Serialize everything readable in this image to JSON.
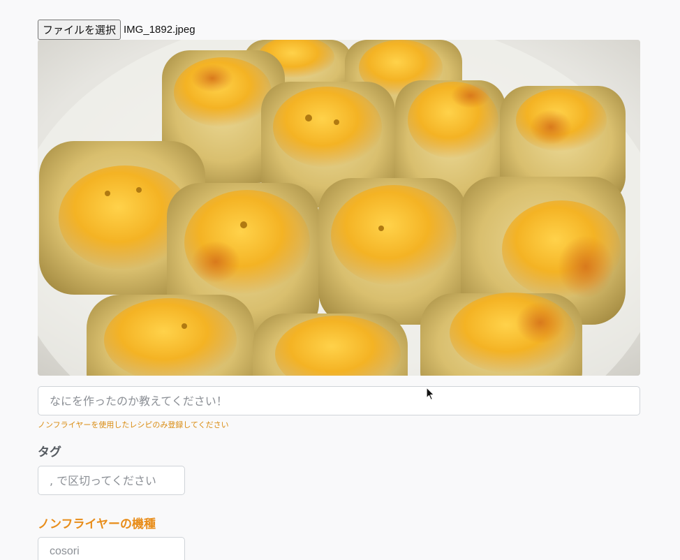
{
  "file_picker": {
    "button_label": "ファイルを選択",
    "file_name": "IMG_1892.jpeg"
  },
  "photo": {
    "subject": "cheese-topped baked bread cubes on a white plate"
  },
  "title_field": {
    "placeholder": "なにを作ったのか教えてください！"
  },
  "hint": {
    "text": "ノンフライヤーを使用したレシピのみ登録してください"
  },
  "tags": {
    "label": "タグ",
    "placeholder": ", で区切ってください"
  },
  "machine": {
    "label": "ノンフライヤーの機種",
    "placeholder": "cosori"
  },
  "colors": {
    "accent_orange": "#e88d1a",
    "hint_orange": "#d98b10",
    "label_gray": "#555a60",
    "input_border": "#cfd3d8"
  },
  "icons": {
    "pointer": "mouse-pointer-icon"
  }
}
